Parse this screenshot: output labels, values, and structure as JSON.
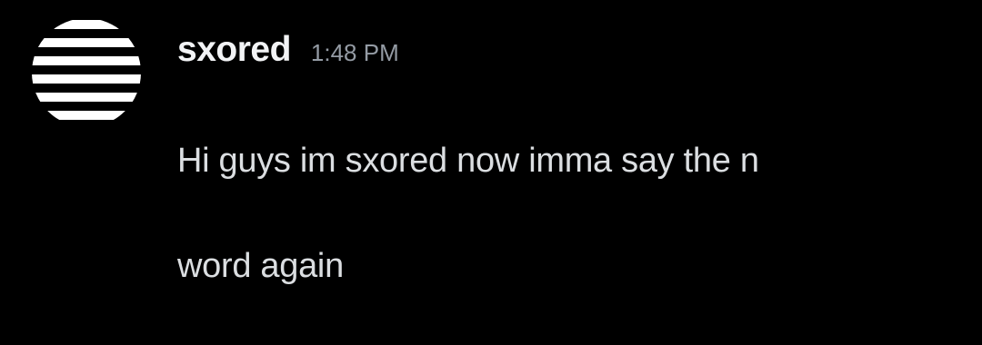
{
  "message": {
    "author": {
      "username": "sxored",
      "avatar_icon": "striped-circle-avatar"
    },
    "timestamp": "1:48 PM",
    "content_lines": [
      "Hi guys im sxored now imma say the n",
      "word again"
    ]
  },
  "colors": {
    "background": "#000000",
    "username": "#f2f3f5",
    "timestamp": "#949ba4",
    "content": "#dbdee1"
  }
}
